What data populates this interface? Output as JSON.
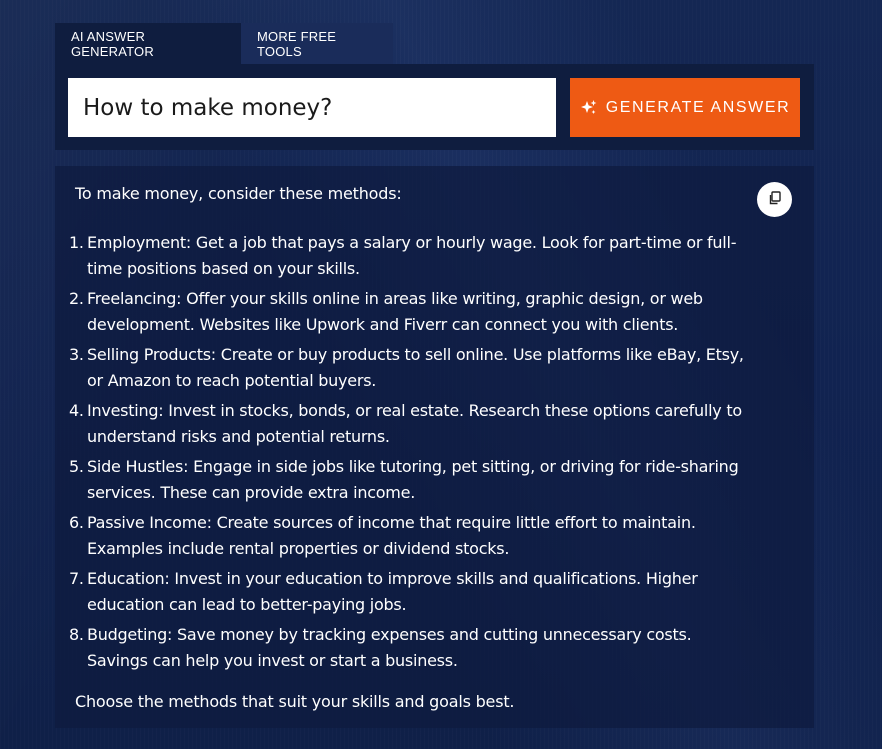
{
  "tabs": [
    {
      "label": "AI ANSWER GENERATOR",
      "active": true
    },
    {
      "label": "MORE FREE TOOLS",
      "active": false
    }
  ],
  "input": {
    "value": "How to make money?"
  },
  "generate_button": {
    "label": "GENERATE ANSWER",
    "icon": "sparkle-icon",
    "color": "#ee5a14"
  },
  "copy_button": {
    "icon": "copy-icon"
  },
  "answer": {
    "intro": "To make money, consider these methods:",
    "methods": [
      {
        "number": "1.",
        "text": "Employment: Get a job that pays a salary or hourly wage. Look for part-time or full-time positions based on your skills."
      },
      {
        "number": "2.",
        "text": "Freelancing: Offer your skills online in areas like writing, graphic design, or web development. Websites like Upwork and Fiverr can connect you with clients."
      },
      {
        "number": "3.",
        "text": "Selling Products: Create or buy products to sell online. Use platforms like eBay, Etsy, or Amazon to reach potential buyers."
      },
      {
        "number": "4.",
        "text": "Investing: Invest in stocks, bonds, or real estate. Research these options carefully to understand risks and potential returns."
      },
      {
        "number": "5.",
        "text": "Side Hustles: Engage in side jobs like tutoring, pet sitting, or driving for ride-sharing services. These can provide extra income."
      },
      {
        "number": "6.",
        "text": "Passive Income: Create sources of income that require little effort to maintain. Examples include rental properties or dividend stocks."
      },
      {
        "number": "7.",
        "text": "Education: Invest in your education to improve skills and qualifications. Higher education can lead to better-paying jobs."
      },
      {
        "number": "8.",
        "text": "Budgeting: Save money by tracking expenses and cutting unnecessary costs. Savings can help you invest or start a business."
      }
    ],
    "closing": "Choose the methods that suit your skills and goals best."
  }
}
